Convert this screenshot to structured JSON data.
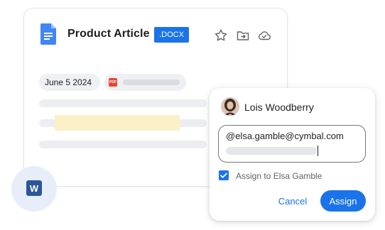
{
  "document": {
    "title": "Product Article",
    "format_badge": ".DOCX",
    "date_chip": "June 5 2024",
    "pdf_icon_text": "PDF",
    "icons": [
      "doc-icon",
      "star-icon",
      "move-to-folder-icon",
      "cloud-done-icon",
      "pdf-icon",
      "word-icon"
    ],
    "word_icon_letter": "W"
  },
  "assign_dialog": {
    "user_name": "Lois Woodberry",
    "email_value": "@elsa.gamble@cymbal.com",
    "checkbox_label": "Assign to Elsa Gamble",
    "checkbox_checked": true,
    "cancel_label": "Cancel",
    "assign_label": "Assign"
  },
  "colors": {
    "accent": "#1a73e8",
    "word_brand": "#2b579a",
    "pdf_red": "#ea4335",
    "highlight": "#fbf1c7"
  }
}
